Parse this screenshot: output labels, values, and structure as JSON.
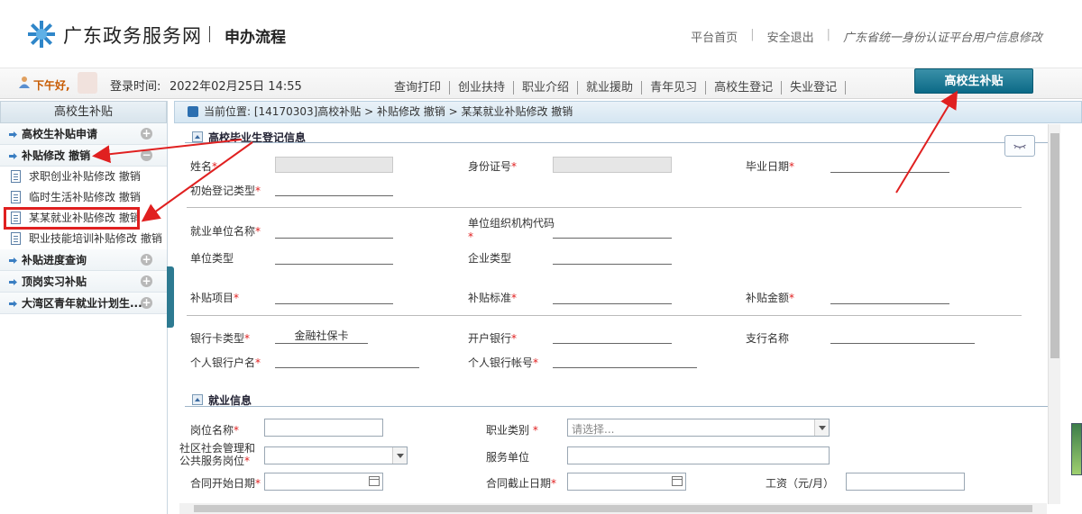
{
  "header": {
    "site_title": "广东政务服务网",
    "process_title": "申办流程",
    "links": [
      "平台首页",
      "安全退出",
      "广东省统一身份认证平台用户信息修改"
    ]
  },
  "userbar": {
    "greeting": "下午好,",
    "login_label": "登录时间:",
    "login_time": "2022年02月25日 14:55",
    "nav": [
      "查询打印",
      "创业扶持",
      "职业介绍",
      "就业援助",
      "青年见习",
      "高校生登记",
      "失业登记"
    ],
    "active_tab": "高校生补贴"
  },
  "sidebar": {
    "title": "高校生补贴",
    "sections": [
      {
        "label": "高校生补贴申请",
        "state": "+"
      },
      {
        "label": "补贴修改 撤销",
        "state": "−"
      }
    ],
    "subitems": [
      "求职创业补贴修改 撤销",
      "临时生活补贴修改 撤销",
      "某某就业补贴修改 撤销",
      "职业技能培训补贴修改 撤销"
    ],
    "sections_after": [
      {
        "label": "补贴进度查询",
        "state": "+"
      },
      {
        "label": "顶岗实习补贴",
        "state": "+"
      },
      {
        "label": "大湾区青年就业计划生...",
        "state": "+"
      }
    ]
  },
  "breadcrumb": "当前位置: [14170303]高校补贴 > 补贴修改 撤销 > 某某就业补贴修改 撤销",
  "form": {
    "section1_title": "高校毕业生登记信息",
    "section2_title": "就业信息",
    "labels": {
      "name": "姓名",
      "id_number": "身份证号",
      "grad_date": "毕业日期",
      "initial_reg_type": "初始登记类型",
      "employer_name": "就业单位名称",
      "org_code": "单位组织机构代码",
      "unit_type": "单位类型",
      "enterprise_type": "企业类型",
      "subsidy_item": "补贴项目",
      "subsidy_standard": "补贴标准",
      "subsidy_amount": "补贴金额",
      "bank_card_type": "银行卡类型",
      "bank": "开户银行",
      "branch": "支行名称",
      "account_name": "个人银行户名",
      "account_number": "个人银行帐号",
      "position": "岗位名称",
      "occupation": "职业类别",
      "community_line1": "社区社会管理和",
      "community_line2": "公共服务岗位",
      "service_unit": "服务单位",
      "contract_start": "合同开始日期",
      "contract_end": "合同截止日期",
      "salary": "工资（元/月）"
    },
    "req_mark": "*",
    "values": {
      "bank_card_type": "金融社保卡",
      "occupation_placeholder": "请选择..."
    }
  },
  "colors": {
    "active_tab": "#0c6a87",
    "greeting": "#c75a00",
    "required": "#e02020",
    "annotation_red": "#e02020"
  }
}
